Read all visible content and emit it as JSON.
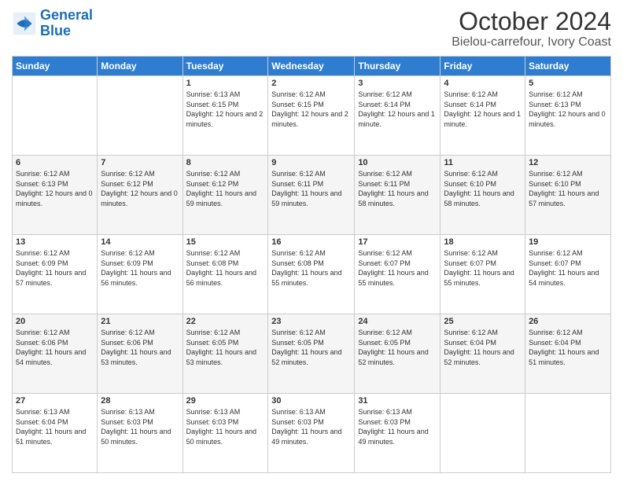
{
  "logo": {
    "text_general": "General",
    "text_blue": "Blue"
  },
  "header": {
    "title": "October 2024",
    "subtitle": "Bielou-carrefour, Ivory Coast"
  },
  "weekdays": [
    "Sunday",
    "Monday",
    "Tuesday",
    "Wednesday",
    "Thursday",
    "Friday",
    "Saturday"
  ],
  "weeks": [
    [
      {
        "day": "",
        "sunrise": "",
        "sunset": "",
        "daylight": ""
      },
      {
        "day": "",
        "sunrise": "",
        "sunset": "",
        "daylight": ""
      },
      {
        "day": "1",
        "sunrise": "Sunrise: 6:13 AM",
        "sunset": "Sunset: 6:15 PM",
        "daylight": "Daylight: 12 hours and 2 minutes."
      },
      {
        "day": "2",
        "sunrise": "Sunrise: 6:12 AM",
        "sunset": "Sunset: 6:15 PM",
        "daylight": "Daylight: 12 hours and 2 minutes."
      },
      {
        "day": "3",
        "sunrise": "Sunrise: 6:12 AM",
        "sunset": "Sunset: 6:14 PM",
        "daylight": "Daylight: 12 hours and 1 minute."
      },
      {
        "day": "4",
        "sunrise": "Sunrise: 6:12 AM",
        "sunset": "Sunset: 6:14 PM",
        "daylight": "Daylight: 12 hours and 1 minute."
      },
      {
        "day": "5",
        "sunrise": "Sunrise: 6:12 AM",
        "sunset": "Sunset: 6:13 PM",
        "daylight": "Daylight: 12 hours and 0 minutes."
      }
    ],
    [
      {
        "day": "6",
        "sunrise": "Sunrise: 6:12 AM",
        "sunset": "Sunset: 6:13 PM",
        "daylight": "Daylight: 12 hours and 0 minutes."
      },
      {
        "day": "7",
        "sunrise": "Sunrise: 6:12 AM",
        "sunset": "Sunset: 6:12 PM",
        "daylight": "Daylight: 12 hours and 0 minutes."
      },
      {
        "day": "8",
        "sunrise": "Sunrise: 6:12 AM",
        "sunset": "Sunset: 6:12 PM",
        "daylight": "Daylight: 11 hours and 59 minutes."
      },
      {
        "day": "9",
        "sunrise": "Sunrise: 6:12 AM",
        "sunset": "Sunset: 6:11 PM",
        "daylight": "Daylight: 11 hours and 59 minutes."
      },
      {
        "day": "10",
        "sunrise": "Sunrise: 6:12 AM",
        "sunset": "Sunset: 6:11 PM",
        "daylight": "Daylight: 11 hours and 58 minutes."
      },
      {
        "day": "11",
        "sunrise": "Sunrise: 6:12 AM",
        "sunset": "Sunset: 6:10 PM",
        "daylight": "Daylight: 11 hours and 58 minutes."
      },
      {
        "day": "12",
        "sunrise": "Sunrise: 6:12 AM",
        "sunset": "Sunset: 6:10 PM",
        "daylight": "Daylight: 11 hours and 57 minutes."
      }
    ],
    [
      {
        "day": "13",
        "sunrise": "Sunrise: 6:12 AM",
        "sunset": "Sunset: 6:09 PM",
        "daylight": "Daylight: 11 hours and 57 minutes."
      },
      {
        "day": "14",
        "sunrise": "Sunrise: 6:12 AM",
        "sunset": "Sunset: 6:09 PM",
        "daylight": "Daylight: 11 hours and 56 minutes."
      },
      {
        "day": "15",
        "sunrise": "Sunrise: 6:12 AM",
        "sunset": "Sunset: 6:08 PM",
        "daylight": "Daylight: 11 hours and 56 minutes."
      },
      {
        "day": "16",
        "sunrise": "Sunrise: 6:12 AM",
        "sunset": "Sunset: 6:08 PM",
        "daylight": "Daylight: 11 hours and 55 minutes."
      },
      {
        "day": "17",
        "sunrise": "Sunrise: 6:12 AM",
        "sunset": "Sunset: 6:07 PM",
        "daylight": "Daylight: 11 hours and 55 minutes."
      },
      {
        "day": "18",
        "sunrise": "Sunrise: 6:12 AM",
        "sunset": "Sunset: 6:07 PM",
        "daylight": "Daylight: 11 hours and 55 minutes."
      },
      {
        "day": "19",
        "sunrise": "Sunrise: 6:12 AM",
        "sunset": "Sunset: 6:07 PM",
        "daylight": "Daylight: 11 hours and 54 minutes."
      }
    ],
    [
      {
        "day": "20",
        "sunrise": "Sunrise: 6:12 AM",
        "sunset": "Sunset: 6:06 PM",
        "daylight": "Daylight: 11 hours and 54 minutes."
      },
      {
        "day": "21",
        "sunrise": "Sunrise: 6:12 AM",
        "sunset": "Sunset: 6:06 PM",
        "daylight": "Daylight: 11 hours and 53 minutes."
      },
      {
        "day": "22",
        "sunrise": "Sunrise: 6:12 AM",
        "sunset": "Sunset: 6:05 PM",
        "daylight": "Daylight: 11 hours and 53 minutes."
      },
      {
        "day": "23",
        "sunrise": "Sunrise: 6:12 AM",
        "sunset": "Sunset: 6:05 PM",
        "daylight": "Daylight: 11 hours and 52 minutes."
      },
      {
        "day": "24",
        "sunrise": "Sunrise: 6:12 AM",
        "sunset": "Sunset: 6:05 PM",
        "daylight": "Daylight: 11 hours and 52 minutes."
      },
      {
        "day": "25",
        "sunrise": "Sunrise: 6:12 AM",
        "sunset": "Sunset: 6:04 PM",
        "daylight": "Daylight: 11 hours and 52 minutes."
      },
      {
        "day": "26",
        "sunrise": "Sunrise: 6:12 AM",
        "sunset": "Sunset: 6:04 PM",
        "daylight": "Daylight: 11 hours and 51 minutes."
      }
    ],
    [
      {
        "day": "27",
        "sunrise": "Sunrise: 6:13 AM",
        "sunset": "Sunset: 6:04 PM",
        "daylight": "Daylight: 11 hours and 51 minutes."
      },
      {
        "day": "28",
        "sunrise": "Sunrise: 6:13 AM",
        "sunset": "Sunset: 6:03 PM",
        "daylight": "Daylight: 11 hours and 50 minutes."
      },
      {
        "day": "29",
        "sunrise": "Sunrise: 6:13 AM",
        "sunset": "Sunset: 6:03 PM",
        "daylight": "Daylight: 11 hours and 50 minutes."
      },
      {
        "day": "30",
        "sunrise": "Sunrise: 6:13 AM",
        "sunset": "Sunset: 6:03 PM",
        "daylight": "Daylight: 11 hours and 49 minutes."
      },
      {
        "day": "31",
        "sunrise": "Sunrise: 6:13 AM",
        "sunset": "Sunset: 6:03 PM",
        "daylight": "Daylight: 11 hours and 49 minutes."
      },
      {
        "day": "",
        "sunrise": "",
        "sunset": "",
        "daylight": ""
      },
      {
        "day": "",
        "sunrise": "",
        "sunset": "",
        "daylight": ""
      }
    ]
  ]
}
